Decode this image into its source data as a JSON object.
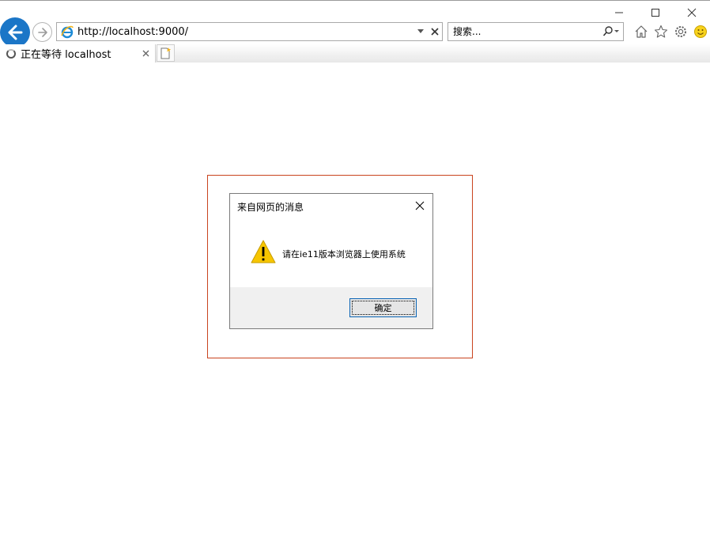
{
  "address_bar": {
    "url": "http://localhost:9000/"
  },
  "search": {
    "placeholder": "搜索..."
  },
  "tab": {
    "title": "正在等待 localhost"
  },
  "dialog": {
    "title": "来自网页的消息",
    "message": "请在ie11版本浏览器上使用系统",
    "ok_label": "确定"
  },
  "icons": {
    "back": "back-arrow-icon",
    "forward": "forward-arrow-icon",
    "ie": "ie-logo-icon",
    "home": "home-icon",
    "favorites": "star-icon",
    "tools": "gear-icon",
    "feedback": "smiley-icon",
    "warning": "warning-icon"
  },
  "colors": {
    "accent": "#1b76c7",
    "frame": "#c9431e",
    "warning": "#f7c600"
  }
}
